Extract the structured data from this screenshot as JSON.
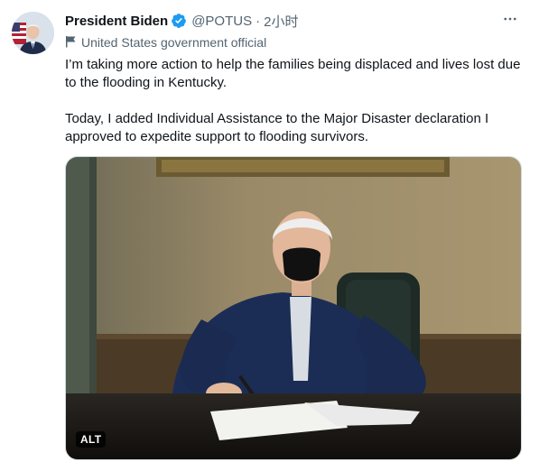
{
  "tweet": {
    "author_name": "President Biden",
    "handle": "@POTUS",
    "separator": "·",
    "time": "2小时",
    "label": "United States government official",
    "paragraphs": [
      "I’m taking more action to help the families being displaced and lives lost due to the flooding in Kentucky.",
      "Today, I added Individual Assistance to the Major Disaster declaration I approved to expedite support to flooding survivors."
    ],
    "media": {
      "alt_badge": "ALT"
    }
  },
  "colors": {
    "verified_blue": "#1d9bf0",
    "secondary_text": "#536471",
    "primary_text": "#0f1419"
  },
  "icons": {
    "verified": "verified-badge-icon",
    "more": "more-options-icon",
    "label": "flag-icon"
  }
}
